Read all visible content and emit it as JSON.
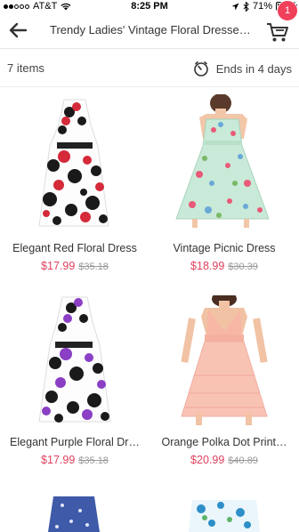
{
  "status_bar": {
    "carrier": "AT&T",
    "time": "8:25 PM",
    "battery": "71%",
    "battery_level": 0.71
  },
  "nav": {
    "title": "Trendy Ladies' Vintage Floral Dresse…",
    "cart_count": "1"
  },
  "info": {
    "items_count": "7 items",
    "ends": "Ends in 4 days"
  },
  "products": [
    {
      "name": "Elegant Red Floral Dress",
      "price": "$17.99",
      "old_price": "$35.18"
    },
    {
      "name": "Vintage Picnic Dress",
      "price": "$18.99",
      "old_price": "$30.39"
    },
    {
      "name": "Elegant Purple Floral Dr…",
      "price": "$17.99",
      "old_price": "$35.18"
    },
    {
      "name": "Orange Polka Dot Print…",
      "price": "$20.99",
      "old_price": "$40.89"
    }
  ],
  "colors": {
    "accent": "#e0405e",
    "badge": "#f0405a"
  }
}
